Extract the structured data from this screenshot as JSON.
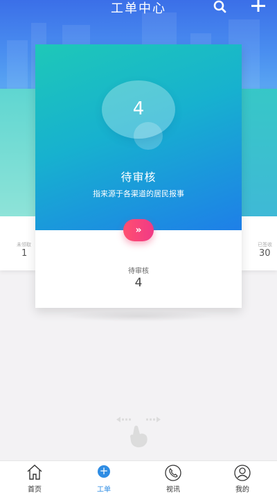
{
  "header": {
    "title": "工单中心",
    "search_icon": "search-icon",
    "add_icon": "plus-icon"
  },
  "carousel": {
    "left_card": {
      "label": "未领取",
      "count": "1"
    },
    "right_card": {
      "label": "已签收",
      "count": "30"
    },
    "current": {
      "count": "4",
      "title": "待审核",
      "description": "指来源于各渠道的居民报事",
      "go_icon": "double-chevron-right-icon",
      "go_symbol": "»",
      "footer_label": "待审核",
      "footer_count": "4"
    }
  },
  "swipe_hint": {
    "icon": "swipe-hand-icon"
  },
  "tabbar": {
    "items": [
      {
        "label": "首页",
        "icon": "home-icon",
        "active": false
      },
      {
        "label": "工单",
        "icon": "plus-circle-icon",
        "active": true,
        "symbol": "+"
      },
      {
        "label": "视讯",
        "icon": "phone-icon",
        "active": false
      },
      {
        "label": "我的",
        "icon": "user-icon",
        "active": false
      }
    ]
  },
  "colors": {
    "header_blue": "#3b6fe8",
    "card_teal": "#1ec8b8",
    "card_blue": "#1e7fe8",
    "button_pink": "#ff4f70",
    "tab_active": "#2f8de4"
  }
}
